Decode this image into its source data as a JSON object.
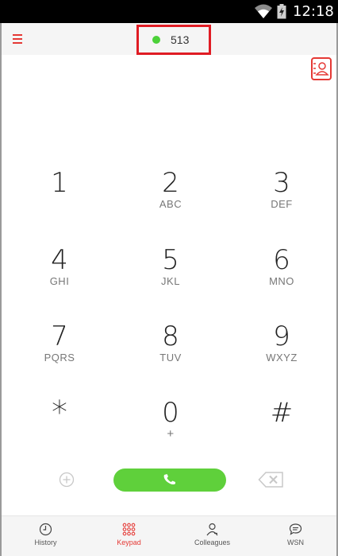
{
  "status_bar": {
    "time": "12:18",
    "icons": [
      "wifi-icon",
      "battery-charging-icon"
    ]
  },
  "header": {
    "menu_icon": "menu-icon",
    "extension": "513",
    "presence_color": "#4cd139"
  },
  "contacts_icon": "contacts-book-icon",
  "keypad": [
    {
      "digit": "1",
      "letters": ""
    },
    {
      "digit": "2",
      "letters": "ABC"
    },
    {
      "digit": "3",
      "letters": "DEF"
    },
    {
      "digit": "4",
      "letters": "GHI"
    },
    {
      "digit": "5",
      "letters": "JKL"
    },
    {
      "digit": "6",
      "letters": "MNO"
    },
    {
      "digit": "7",
      "letters": "PQRS"
    },
    {
      "digit": "8",
      "letters": "TUV"
    },
    {
      "digit": "9",
      "letters": "WXYZ"
    },
    {
      "digit": "*",
      "letters": ""
    },
    {
      "digit": "0",
      "letters": "+"
    },
    {
      "digit": "#",
      "letters": ""
    }
  ],
  "actions": {
    "add_call_icon": "add-circle-icon",
    "call_icon": "phone-icon",
    "backspace_icon": "backspace-icon"
  },
  "colors": {
    "accent": "#e53935",
    "call": "#5fd03b",
    "highlight_box": "#e01c24"
  },
  "nav": [
    {
      "label": "History",
      "icon": "clock-icon",
      "active": false
    },
    {
      "label": "Keypad",
      "icon": "keypad-icon",
      "active": true
    },
    {
      "label": "Colleagues",
      "icon": "colleagues-icon",
      "active": false
    },
    {
      "label": "WSN",
      "icon": "chat-bubble-icon",
      "active": false
    }
  ]
}
